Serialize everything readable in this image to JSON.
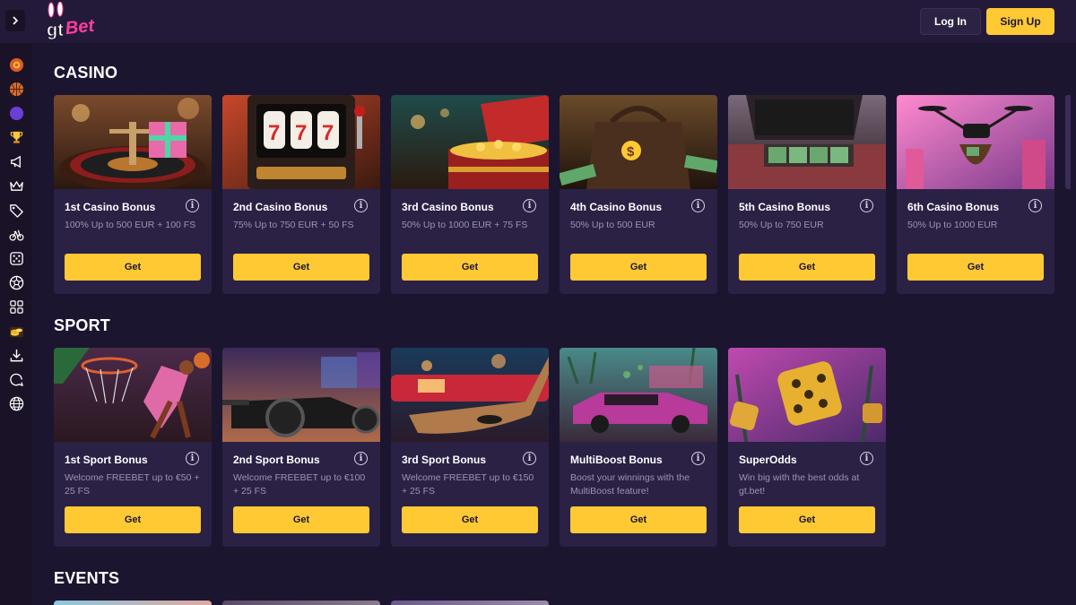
{
  "header": {
    "logo_text": "gtBet",
    "login_label": "Log In",
    "signup_label": "Sign Up"
  },
  "sidebar": {
    "items": [
      {
        "icon": "casino-chip-icon"
      },
      {
        "icon": "basketball-icon"
      },
      {
        "icon": "moon-icon"
      },
      {
        "icon": "trophy-icon"
      },
      {
        "icon": "megaphone-icon"
      },
      {
        "icon": "crown-icon"
      },
      {
        "icon": "tag-icon"
      },
      {
        "icon": "bicycle-icon"
      },
      {
        "icon": "dice-icon"
      },
      {
        "icon": "soccer-ball-icon"
      },
      {
        "icon": "grid-icon"
      },
      {
        "icon": "coins-icon"
      },
      {
        "icon": "download-icon"
      },
      {
        "icon": "chat-icon"
      },
      {
        "icon": "globe-icon"
      }
    ]
  },
  "sections": {
    "casino": {
      "title": "CASINO",
      "cards": [
        {
          "title": "1st Casino Bonus",
          "desc": "100% Up to 500 EUR + 100 FS",
          "button": "Get",
          "image": "roulette-gift-image"
        },
        {
          "title": "2nd Casino Bonus",
          "desc": "75% Up to 750 EUR + 50 FS",
          "button": "Get",
          "image": "slot-machine-image"
        },
        {
          "title": "3rd Casino Bonus",
          "desc": "50% Up to 1000 EUR + 75 FS",
          "button": "Get",
          "image": "treasure-chest-image"
        },
        {
          "title": "4th Casino Bonus",
          "desc": "50% Up to 500 EUR",
          "button": "Get",
          "image": "money-bag-image"
        },
        {
          "title": "5th Casino Bonus",
          "desc": "50% Up to 750 EUR",
          "button": "Get",
          "image": "car-trunk-cash-image"
        },
        {
          "title": "6th Casino Bonus",
          "desc": "50% Up to 1000 EUR",
          "button": "Get",
          "image": "drone-money-image"
        }
      ]
    },
    "sport": {
      "title": "SPORT",
      "cards": [
        {
          "title": "1st Sport Bonus",
          "desc": "Welcome FREEBET up to €50 + 25 FS",
          "button": "Get",
          "image": "basketball-dunk-image"
        },
        {
          "title": "2nd Sport Bonus",
          "desc": "Welcome FREEBET up to €100 + 25 FS",
          "button": "Get",
          "image": "race-car-image"
        },
        {
          "title": "3rd Sport Bonus",
          "desc": "Welcome FREEBET up to €150 + 25 FS",
          "button": "Get",
          "image": "hockey-stick-image"
        },
        {
          "title": "MultiBoost Bonus",
          "desc": "Boost your winnings with the MultiBoost feature!",
          "button": "Get",
          "image": "sports-car-image"
        },
        {
          "title": "SuperOdds",
          "desc": "Win big with the best odds at gt.bet!",
          "button": "Get",
          "image": "golden-dice-image"
        }
      ]
    },
    "events": {
      "title": "EVENTS"
    }
  },
  "colors": {
    "accent": "#ffc934",
    "background": "#1c1530",
    "card": "#2a2145",
    "logo_pink": "#ff3d9a"
  }
}
